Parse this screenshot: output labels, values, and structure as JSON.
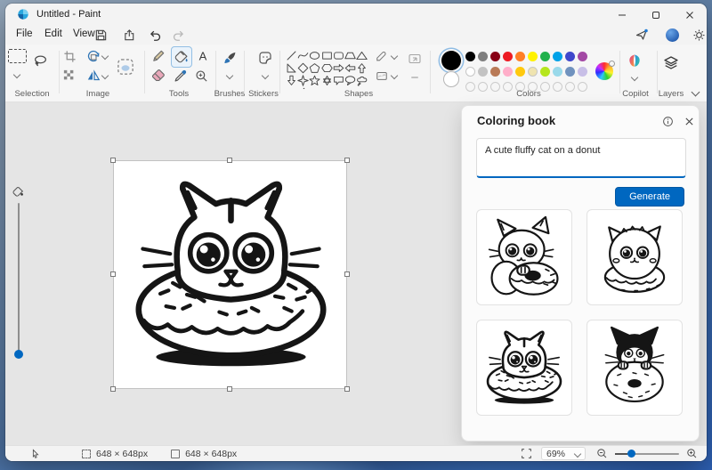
{
  "window": {
    "title": "Untitled - Paint",
    "controls": [
      "minimize",
      "maximize",
      "close"
    ]
  },
  "menubar": {
    "items": [
      "File",
      "Edit",
      "View"
    ],
    "quick_icons": [
      "save",
      "share",
      "undo",
      "redo"
    ],
    "right_icons": [
      "send",
      "account",
      "settings"
    ]
  },
  "ribbon": {
    "selection": {
      "label": "Selection"
    },
    "image": {
      "label": "Image"
    },
    "tools": {
      "label": "Tools",
      "selected_tool": "fill"
    },
    "brushes": {
      "label": "Brushes"
    },
    "stickers": {
      "label": "Stickers"
    },
    "shapes": {
      "label": "Shapes",
      "items": [
        "line",
        "curve",
        "oval",
        "rectangle",
        "rounded-rectangle",
        "trapezoid",
        "triangle",
        "right-triangle",
        "diamond",
        "pentagon",
        "hexagon",
        "right-arrow",
        "left-arrow",
        "up-arrow",
        "down-arrow",
        "four-point-star",
        "five-point-star",
        "six-point-star",
        "rounded-callout",
        "oval-callout",
        "cloud-callout",
        "heart",
        "lightning"
      ]
    },
    "colors": {
      "label": "Colors",
      "color1": "#000000",
      "color2": "#FFFFFF",
      "palette_row1": [
        "#000000",
        "#7F7F7F",
        "#880015",
        "#ED1C24",
        "#FF7F27",
        "#FFF200",
        "#22B14C",
        "#00A2E8",
        "#3F48CC",
        "#A349A4"
      ],
      "palette_row2": [
        "#FFFFFF",
        "#C3C3C3",
        "#B97A57",
        "#FFAEC9",
        "#FFC90E",
        "#EFE4B0",
        "#B5E61D",
        "#99D9EA",
        "#7092BE",
        "#C8BFE7"
      ],
      "empty_slots": 10
    },
    "copilot": {
      "label": "Copilot"
    },
    "layers": {
      "label": "Layers"
    }
  },
  "canvas": {
    "artwork": "cat-head-in-donut",
    "selection_handles": 8
  },
  "panel": {
    "title": "Coloring book",
    "prompt_value": "A cute fluffy cat on a donut",
    "generate_label": "Generate",
    "thumbnails": [
      "cat-hugging-donut",
      "fluffy-cat-on-donut",
      "cat-head-in-donut",
      "black-cat-behind-donut"
    ]
  },
  "statusbar": {
    "selection_size": "648 × 648px",
    "canvas_size": "648 × 648px",
    "zoom_level": "69%"
  },
  "theme": {
    "accent": "#0067C0"
  }
}
